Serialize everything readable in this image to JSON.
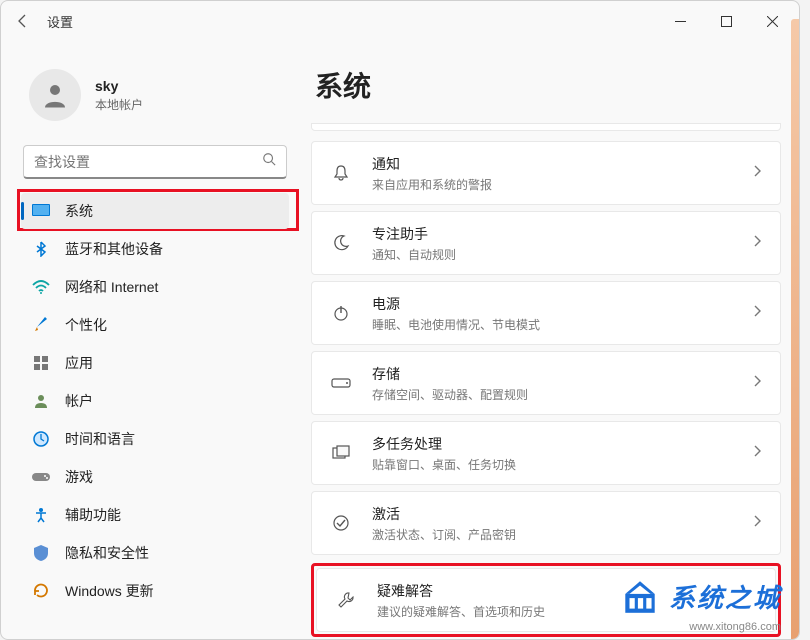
{
  "app": {
    "title": "设置"
  },
  "profile": {
    "username": "sky",
    "account_type": "本地帐户"
  },
  "search": {
    "placeholder": "查找设置"
  },
  "nav": {
    "items": [
      {
        "label": "系统"
      },
      {
        "label": "蓝牙和其他设备"
      },
      {
        "label": "网络和 Internet"
      },
      {
        "label": "个性化"
      },
      {
        "label": "应用"
      },
      {
        "label": "帐户"
      },
      {
        "label": "时间和语言"
      },
      {
        "label": "游戏"
      },
      {
        "label": "辅助功能"
      },
      {
        "label": "隐私和安全性"
      },
      {
        "label": "Windows 更新"
      }
    ]
  },
  "main": {
    "title": "系统",
    "cards": [
      {
        "title": "通知",
        "sub": "来自应用和系统的警报"
      },
      {
        "title": "专注助手",
        "sub": "通知、自动规则"
      },
      {
        "title": "电源",
        "sub": "睡眠、电池使用情况、节电模式"
      },
      {
        "title": "存储",
        "sub": "存储空间、驱动器、配置规则"
      },
      {
        "title": "多任务处理",
        "sub": "贴靠窗口、桌面、任务切换"
      },
      {
        "title": "激活",
        "sub": "激活状态、订阅、产品密钥"
      },
      {
        "title": "疑难解答",
        "sub": "建议的疑难解答、首选项和历史"
      }
    ]
  },
  "watermark": {
    "text": "系统之城",
    "url": "www.xitong86.com"
  }
}
